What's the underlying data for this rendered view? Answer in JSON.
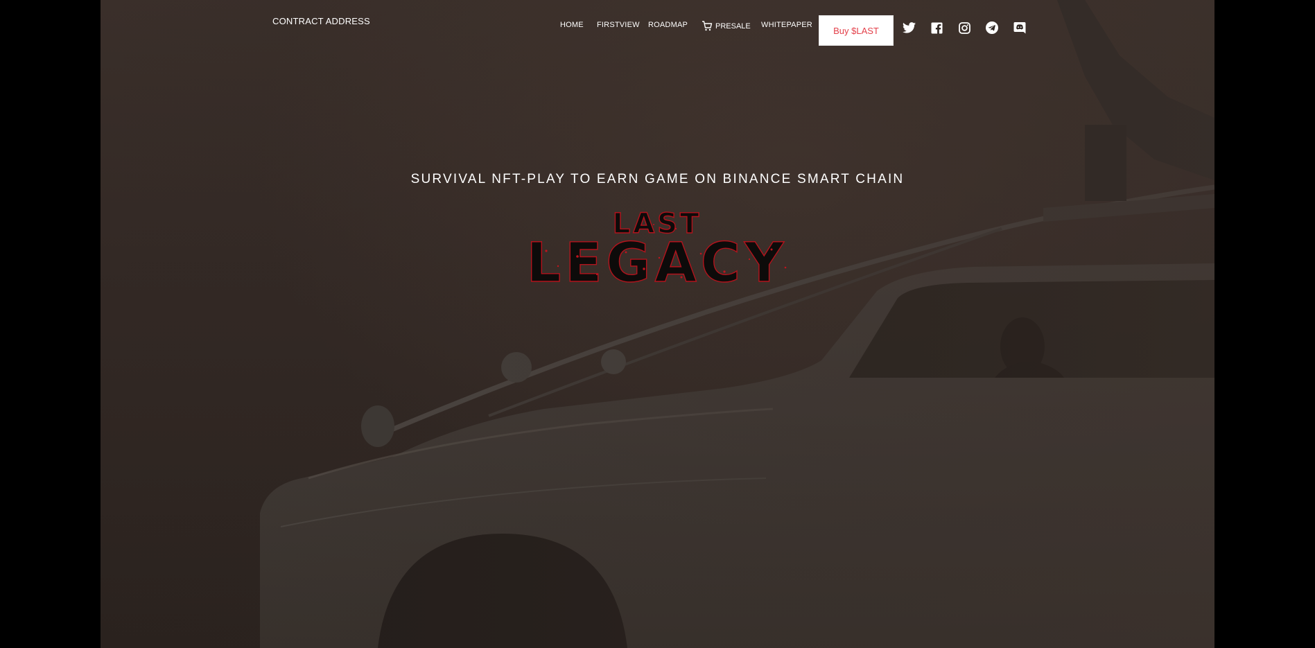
{
  "header": {
    "contract_label": "CONTRACT ADDRESS",
    "nav": [
      {
        "label": "HOME"
      },
      {
        "label": "FIRSTVIEW"
      },
      {
        "label": "ROADMAP"
      },
      {
        "label": "PRESALE",
        "icon": "cart-icon"
      },
      {
        "label": "WHITEPAPER"
      }
    ],
    "buy_button": "Buy $LAST",
    "social_icons": [
      "twitter-icon",
      "facebook-icon",
      "instagram-icon",
      "telegram-icon",
      "discord-icon"
    ]
  },
  "hero": {
    "tagline": "SURVIVAL NFT-PLAY TO EARN GAME ON BINANCE SMART CHAIN",
    "logo_line1": "LAST",
    "logo_line2": "LEGACY"
  },
  "colors": {
    "page_bg": "#000000",
    "hero_overlay": "#2f2622",
    "text": "#ffffff",
    "accent_red": "#e3404a",
    "logo_red": "#b3131c"
  }
}
